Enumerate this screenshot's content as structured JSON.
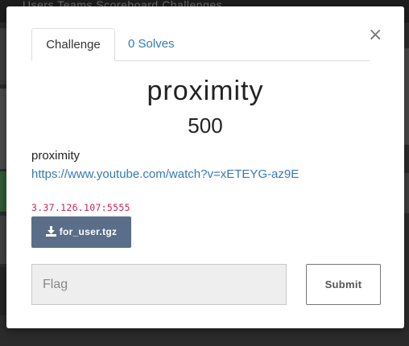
{
  "background": {
    "nav_text": "Users    Teams    Scoreboard    Challenges"
  },
  "modal": {
    "tabs": [
      {
        "label": "Challenge",
        "active": true
      },
      {
        "label": "0 Solves",
        "active": false
      }
    ],
    "close_icon": "close-icon",
    "challenge": {
      "name": "proximity",
      "points": "500",
      "description": "proximity",
      "link": "https://www.youtube.com/watch?v=xETEYG-az9E",
      "connection": "3.37.126.107:5555"
    },
    "download": {
      "icon": "download-icon",
      "label": "for_user.tgz"
    },
    "flag": {
      "placeholder": "Flag",
      "value": ""
    },
    "submit_label": "Submit"
  },
  "colors": {
    "accent": "#337ab7",
    "download_bg": "#5a6e8a",
    "code": "#c7254e"
  }
}
